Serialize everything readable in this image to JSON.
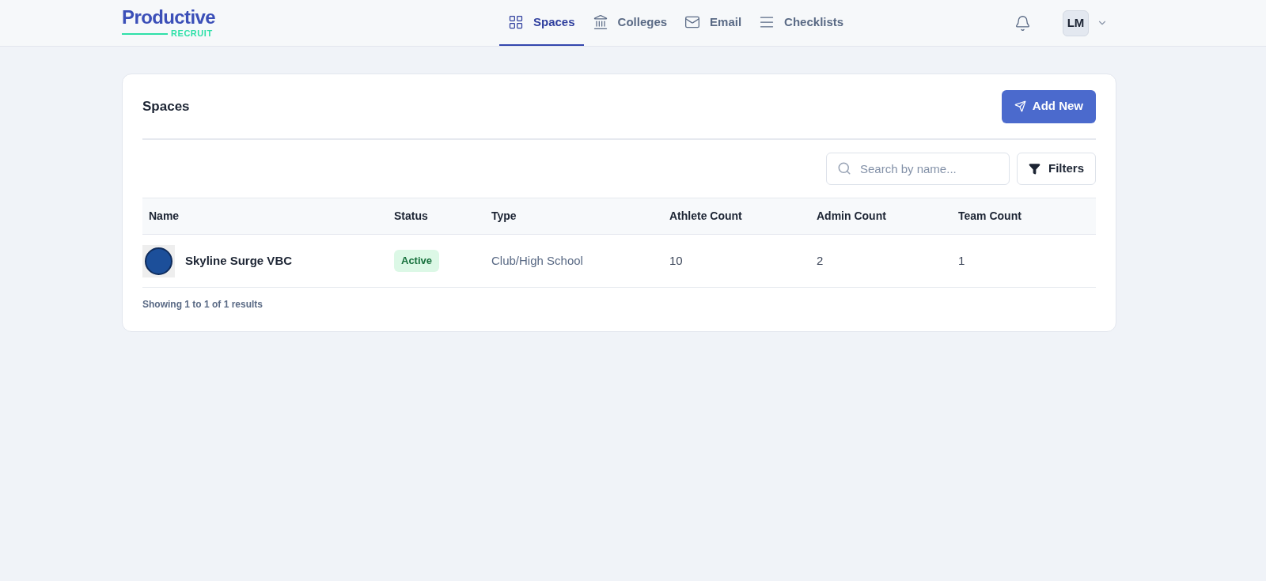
{
  "logo": {
    "word": "Productive",
    "sub": "RECRUIT"
  },
  "nav": [
    {
      "label": "Spaces",
      "selected": true
    },
    {
      "label": "Colleges",
      "selected": false
    },
    {
      "label": "Email",
      "selected": false
    },
    {
      "label": "Checklists",
      "selected": false
    }
  ],
  "user": {
    "initials": "LM"
  },
  "card": {
    "title": "Spaces",
    "add_button": "Add New",
    "search": {
      "placeholder": "Search by name..."
    },
    "filters_button": "Filters"
  },
  "table": {
    "columns": [
      "Name",
      "Status",
      "Type",
      "Athlete Count",
      "Admin Count",
      "Team Count"
    ],
    "rows": [
      {
        "name": "Skyline Surge VBC",
        "status": "Active",
        "type": "Club/High School",
        "athlete_count": "10",
        "admin_count": "2",
        "team_count": "1"
      }
    ]
  },
  "footer": "Showing 1 to 1 of 1 results"
}
